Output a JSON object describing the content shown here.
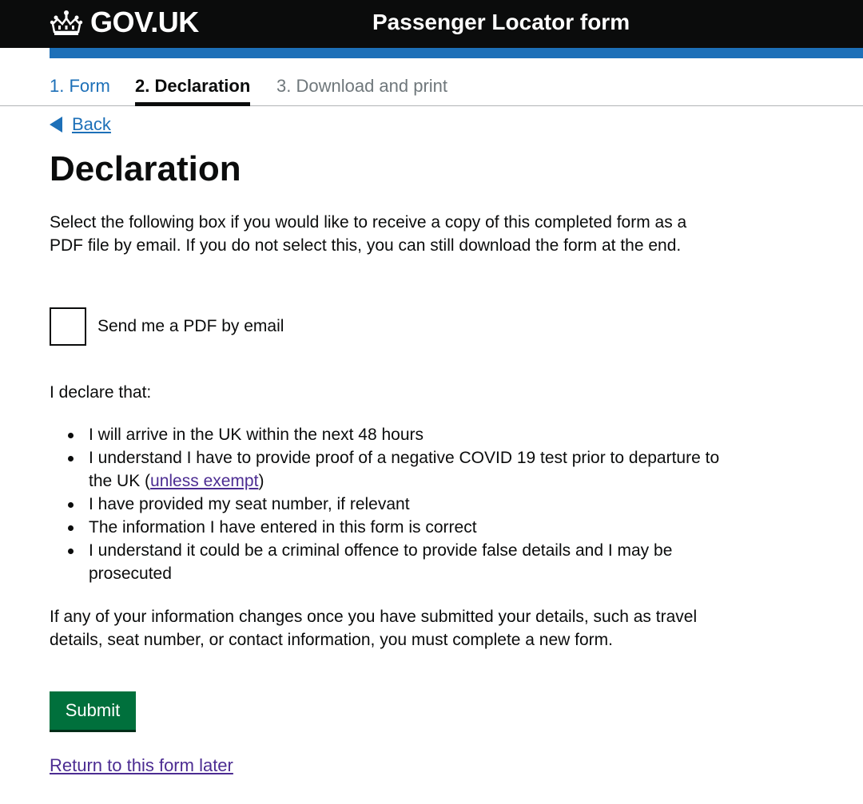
{
  "header": {
    "logo_text": "GOV.UK",
    "service_name": "Passenger Locator form"
  },
  "steps": [
    {
      "label": "1. Form",
      "state": "link"
    },
    {
      "label": "2. Declaration",
      "state": "current"
    },
    {
      "label": "3. Download and print",
      "state": "upcoming"
    }
  ],
  "back": {
    "label": "Back"
  },
  "page": {
    "title": "Declaration",
    "intro": "Select the following box if you would like to receive a copy of this completed form as a PDF file by email. If you do not select this, you can still download the form at the end.",
    "checkbox": {
      "label": "Send me a PDF by email",
      "checked": false
    },
    "declare_heading": "I declare that:",
    "declarations": [
      {
        "text": "I will arrive in the UK within the next 48 hours"
      },
      {
        "text_before": "I understand I have to provide proof of a negative COVID 19 test prior to departure to the UK (",
        "link": "unless exempt",
        "text_after": ")"
      },
      {
        "text": "I have provided my seat number, if relevant"
      },
      {
        "text": "The information I have entered in this form is correct"
      },
      {
        "text": "I understand it could be a criminal offence to provide false details and I may be prosecuted"
      }
    ],
    "changes_notice": "If any of your information changes once you have submitted your details, such as travel details, seat number, or contact information, you must complete a new form."
  },
  "actions": {
    "submit_label": "Submit",
    "return_link": "Return to this form later"
  },
  "colors": {
    "header_bg": "#0b0c0c",
    "brand_blue": "#1d70b8",
    "link": "#1d70b8",
    "visited_link": "#4c2c92",
    "submit_green": "#00703c",
    "muted_text": "#6f777b"
  },
  "icons": {
    "logo": "crown-icon",
    "back": "triangle-left-icon"
  }
}
